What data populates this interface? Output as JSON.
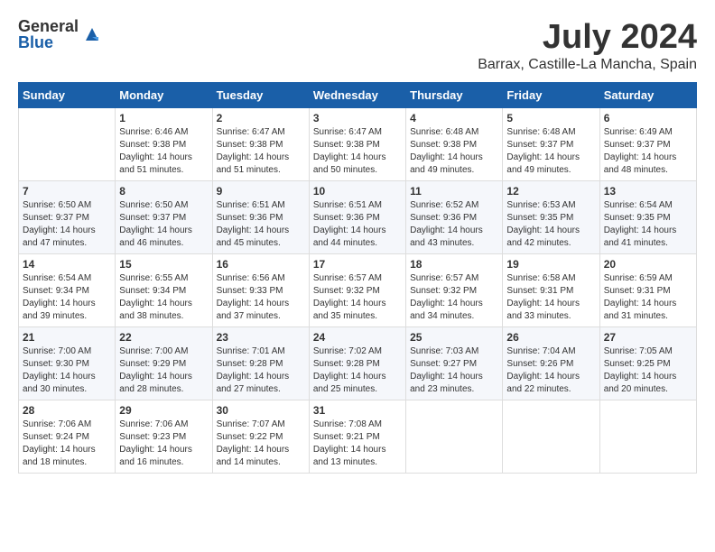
{
  "header": {
    "logo_general": "General",
    "logo_blue": "Blue",
    "month": "July 2024",
    "location": "Barrax, Castille-La Mancha, Spain"
  },
  "weekdays": [
    "Sunday",
    "Monday",
    "Tuesday",
    "Wednesday",
    "Thursday",
    "Friday",
    "Saturday"
  ],
  "weeks": [
    [
      {
        "day": "",
        "sunrise": "",
        "sunset": "",
        "daylight": ""
      },
      {
        "day": "1",
        "sunrise": "Sunrise: 6:46 AM",
        "sunset": "Sunset: 9:38 PM",
        "daylight": "Daylight: 14 hours and 51 minutes."
      },
      {
        "day": "2",
        "sunrise": "Sunrise: 6:47 AM",
        "sunset": "Sunset: 9:38 PM",
        "daylight": "Daylight: 14 hours and 51 minutes."
      },
      {
        "day": "3",
        "sunrise": "Sunrise: 6:47 AM",
        "sunset": "Sunset: 9:38 PM",
        "daylight": "Daylight: 14 hours and 50 minutes."
      },
      {
        "day": "4",
        "sunrise": "Sunrise: 6:48 AM",
        "sunset": "Sunset: 9:38 PM",
        "daylight": "Daylight: 14 hours and 49 minutes."
      },
      {
        "day": "5",
        "sunrise": "Sunrise: 6:48 AM",
        "sunset": "Sunset: 9:37 PM",
        "daylight": "Daylight: 14 hours and 49 minutes."
      },
      {
        "day": "6",
        "sunrise": "Sunrise: 6:49 AM",
        "sunset": "Sunset: 9:37 PM",
        "daylight": "Daylight: 14 hours and 48 minutes."
      }
    ],
    [
      {
        "day": "7",
        "sunrise": "Sunrise: 6:50 AM",
        "sunset": "Sunset: 9:37 PM",
        "daylight": "Daylight: 14 hours and 47 minutes."
      },
      {
        "day": "8",
        "sunrise": "Sunrise: 6:50 AM",
        "sunset": "Sunset: 9:37 PM",
        "daylight": "Daylight: 14 hours and 46 minutes."
      },
      {
        "day": "9",
        "sunrise": "Sunrise: 6:51 AM",
        "sunset": "Sunset: 9:36 PM",
        "daylight": "Daylight: 14 hours and 45 minutes."
      },
      {
        "day": "10",
        "sunrise": "Sunrise: 6:51 AM",
        "sunset": "Sunset: 9:36 PM",
        "daylight": "Daylight: 14 hours and 44 minutes."
      },
      {
        "day": "11",
        "sunrise": "Sunrise: 6:52 AM",
        "sunset": "Sunset: 9:36 PM",
        "daylight": "Daylight: 14 hours and 43 minutes."
      },
      {
        "day": "12",
        "sunrise": "Sunrise: 6:53 AM",
        "sunset": "Sunset: 9:35 PM",
        "daylight": "Daylight: 14 hours and 42 minutes."
      },
      {
        "day": "13",
        "sunrise": "Sunrise: 6:54 AM",
        "sunset": "Sunset: 9:35 PM",
        "daylight": "Daylight: 14 hours and 41 minutes."
      }
    ],
    [
      {
        "day": "14",
        "sunrise": "Sunrise: 6:54 AM",
        "sunset": "Sunset: 9:34 PM",
        "daylight": "Daylight: 14 hours and 39 minutes."
      },
      {
        "day": "15",
        "sunrise": "Sunrise: 6:55 AM",
        "sunset": "Sunset: 9:34 PM",
        "daylight": "Daylight: 14 hours and 38 minutes."
      },
      {
        "day": "16",
        "sunrise": "Sunrise: 6:56 AM",
        "sunset": "Sunset: 9:33 PM",
        "daylight": "Daylight: 14 hours and 37 minutes."
      },
      {
        "day": "17",
        "sunrise": "Sunrise: 6:57 AM",
        "sunset": "Sunset: 9:32 PM",
        "daylight": "Daylight: 14 hours and 35 minutes."
      },
      {
        "day": "18",
        "sunrise": "Sunrise: 6:57 AM",
        "sunset": "Sunset: 9:32 PM",
        "daylight": "Daylight: 14 hours and 34 minutes."
      },
      {
        "day": "19",
        "sunrise": "Sunrise: 6:58 AM",
        "sunset": "Sunset: 9:31 PM",
        "daylight": "Daylight: 14 hours and 33 minutes."
      },
      {
        "day": "20",
        "sunrise": "Sunrise: 6:59 AM",
        "sunset": "Sunset: 9:31 PM",
        "daylight": "Daylight: 14 hours and 31 minutes."
      }
    ],
    [
      {
        "day": "21",
        "sunrise": "Sunrise: 7:00 AM",
        "sunset": "Sunset: 9:30 PM",
        "daylight": "Daylight: 14 hours and 30 minutes."
      },
      {
        "day": "22",
        "sunrise": "Sunrise: 7:00 AM",
        "sunset": "Sunset: 9:29 PM",
        "daylight": "Daylight: 14 hours and 28 minutes."
      },
      {
        "day": "23",
        "sunrise": "Sunrise: 7:01 AM",
        "sunset": "Sunset: 9:28 PM",
        "daylight": "Daylight: 14 hours and 27 minutes."
      },
      {
        "day": "24",
        "sunrise": "Sunrise: 7:02 AM",
        "sunset": "Sunset: 9:28 PM",
        "daylight": "Daylight: 14 hours and 25 minutes."
      },
      {
        "day": "25",
        "sunrise": "Sunrise: 7:03 AM",
        "sunset": "Sunset: 9:27 PM",
        "daylight": "Daylight: 14 hours and 23 minutes."
      },
      {
        "day": "26",
        "sunrise": "Sunrise: 7:04 AM",
        "sunset": "Sunset: 9:26 PM",
        "daylight": "Daylight: 14 hours and 22 minutes."
      },
      {
        "day": "27",
        "sunrise": "Sunrise: 7:05 AM",
        "sunset": "Sunset: 9:25 PM",
        "daylight": "Daylight: 14 hours and 20 minutes."
      }
    ],
    [
      {
        "day": "28",
        "sunrise": "Sunrise: 7:06 AM",
        "sunset": "Sunset: 9:24 PM",
        "daylight": "Daylight: 14 hours and 18 minutes."
      },
      {
        "day": "29",
        "sunrise": "Sunrise: 7:06 AM",
        "sunset": "Sunset: 9:23 PM",
        "daylight": "Daylight: 14 hours and 16 minutes."
      },
      {
        "day": "30",
        "sunrise": "Sunrise: 7:07 AM",
        "sunset": "Sunset: 9:22 PM",
        "daylight": "Daylight: 14 hours and 14 minutes."
      },
      {
        "day": "31",
        "sunrise": "Sunrise: 7:08 AM",
        "sunset": "Sunset: 9:21 PM",
        "daylight": "Daylight: 14 hours and 13 minutes."
      },
      {
        "day": "",
        "sunrise": "",
        "sunset": "",
        "daylight": ""
      },
      {
        "day": "",
        "sunrise": "",
        "sunset": "",
        "daylight": ""
      },
      {
        "day": "",
        "sunrise": "",
        "sunset": "",
        "daylight": ""
      }
    ]
  ]
}
